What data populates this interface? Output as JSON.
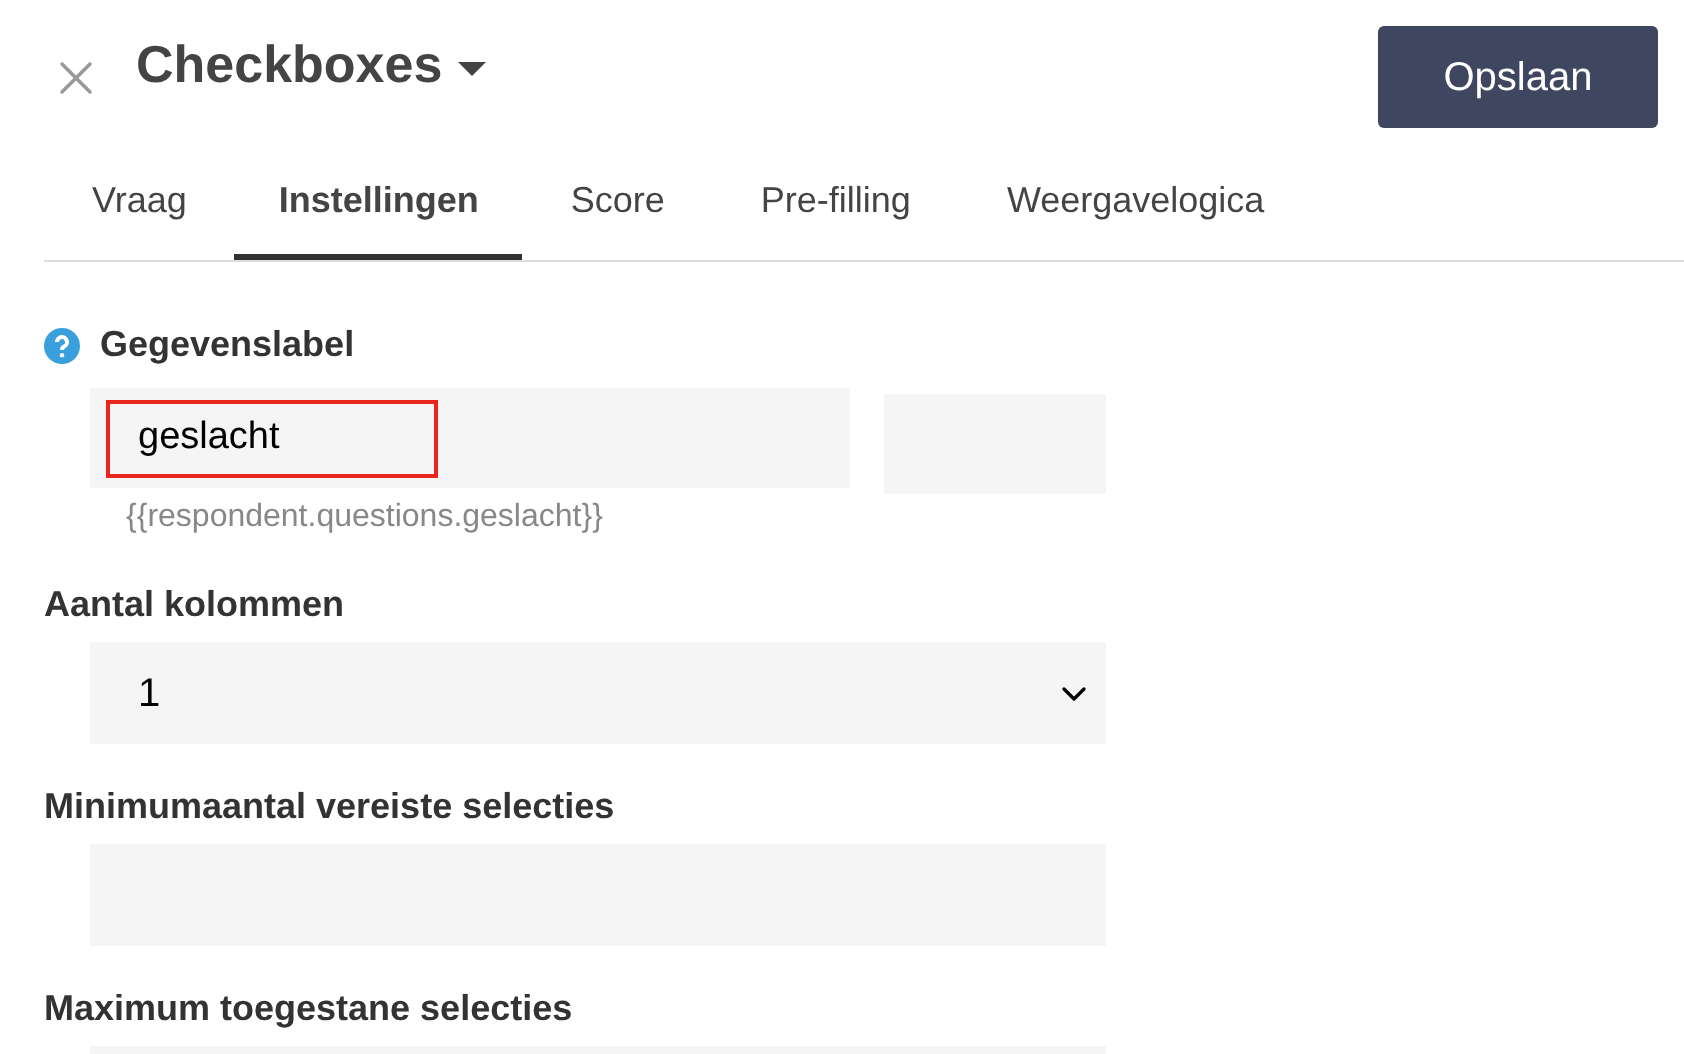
{
  "header": {
    "title": "Checkboxes",
    "save_button": "Opslaan"
  },
  "tabs": [
    {
      "label": "Vraag",
      "selected": false
    },
    {
      "label": "Instellingen",
      "selected": true
    },
    {
      "label": "Score",
      "selected": false
    },
    {
      "label": "Pre-filling",
      "selected": false
    },
    {
      "label": "Weergavelogica",
      "selected": false
    }
  ],
  "data_label": {
    "label": "Gegevenslabel",
    "value": "geslacht",
    "highlighted": true,
    "hint": "{{respondent.questions.geslacht}}"
  },
  "fields": [
    {
      "kind": "select",
      "label": "Aantal kolommen",
      "value": "1"
    },
    {
      "kind": "text",
      "label": "Minimumaantal vereiste selecties"
    },
    {
      "kind": "text",
      "label": "Maximum toegestane selecties"
    }
  ]
}
